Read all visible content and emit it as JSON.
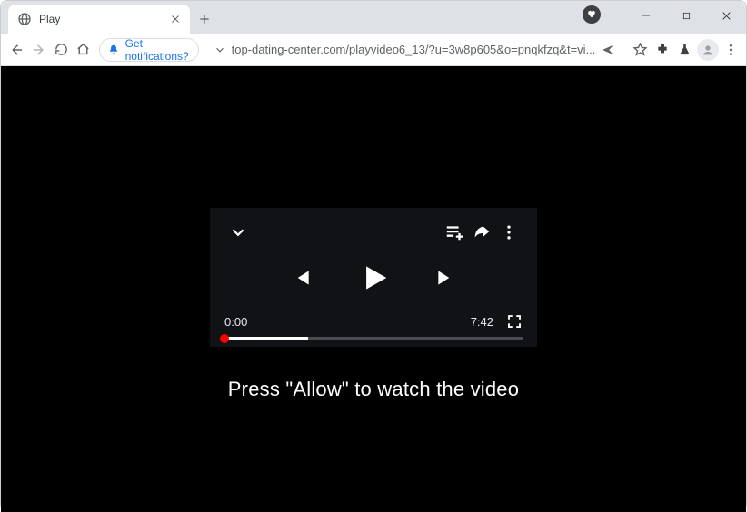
{
  "window": {
    "tab_title": "Play"
  },
  "toolbar": {
    "notification_label": "Get notifications?",
    "url": "top-dating-center.com/playvideo6_13/?u=3w8p605&o=pnqkfzq&t=vi..."
  },
  "player": {
    "current_time": "0:00",
    "duration": "7:42"
  },
  "page": {
    "cta": "Press \"Allow\" to watch the video"
  }
}
